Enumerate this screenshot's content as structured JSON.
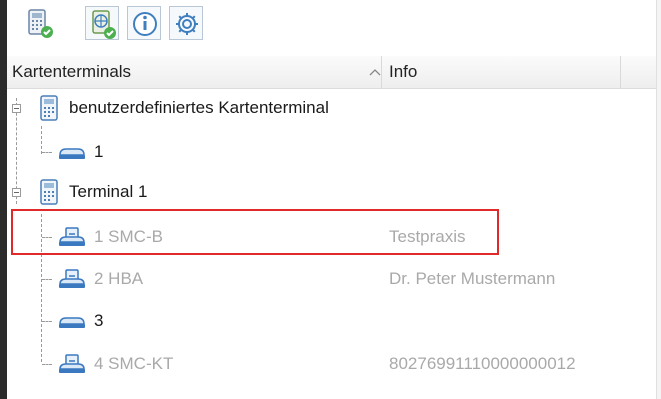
{
  "toolbar": {
    "buttons": [
      {
        "name": "card-terminal-config-icon"
      },
      {
        "name": "network-config-icon"
      },
      {
        "name": "info-icon"
      },
      {
        "name": "gear-icon"
      }
    ]
  },
  "table": {
    "columns": [
      "Kartenterminals",
      "Info"
    ]
  },
  "tree": {
    "node1": {
      "label": "benutzerdefiniertes Kartenterminal",
      "children": [
        {
          "label": "1",
          "info": ""
        }
      ]
    },
    "node2": {
      "label": "Terminal 1",
      "children": [
        {
          "label": "1 SMC-B",
          "info": "Testpraxis"
        },
        {
          "label": "2 HBA",
          "info": "Dr. Peter Mustermann"
        },
        {
          "label": "3",
          "info": ""
        },
        {
          "label": "4 SMC-KT",
          "info": "80276991110000000012"
        }
      ]
    }
  },
  "colors": {
    "accent": "#1a73c8",
    "highlight": "#e02a2a",
    "ok": "#4caf50",
    "muted": "#a9a9a9"
  }
}
